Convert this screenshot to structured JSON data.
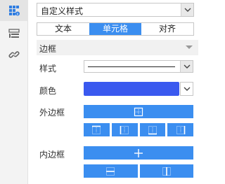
{
  "style_preset": {
    "value": "自定义样式"
  },
  "tabs": [
    {
      "label": "文本",
      "active": false
    },
    {
      "label": "单元格",
      "active": true
    },
    {
      "label": "对齐",
      "active": false
    }
  ],
  "border_section": {
    "title": "边框",
    "style_label": "样式",
    "color_label": "颜色",
    "color_value": "#3a59ef",
    "outer_label": "外边框",
    "inner_label": "内边框"
  },
  "colors": {
    "accent": "#3b8ef0",
    "sidebar_active_icon": "#2f7de1",
    "sidebar_icon": "#666666"
  },
  "sidebar_icons": [
    "cell-attributes-icon",
    "widget-settings-icon",
    "hyperlink-icon"
  ]
}
